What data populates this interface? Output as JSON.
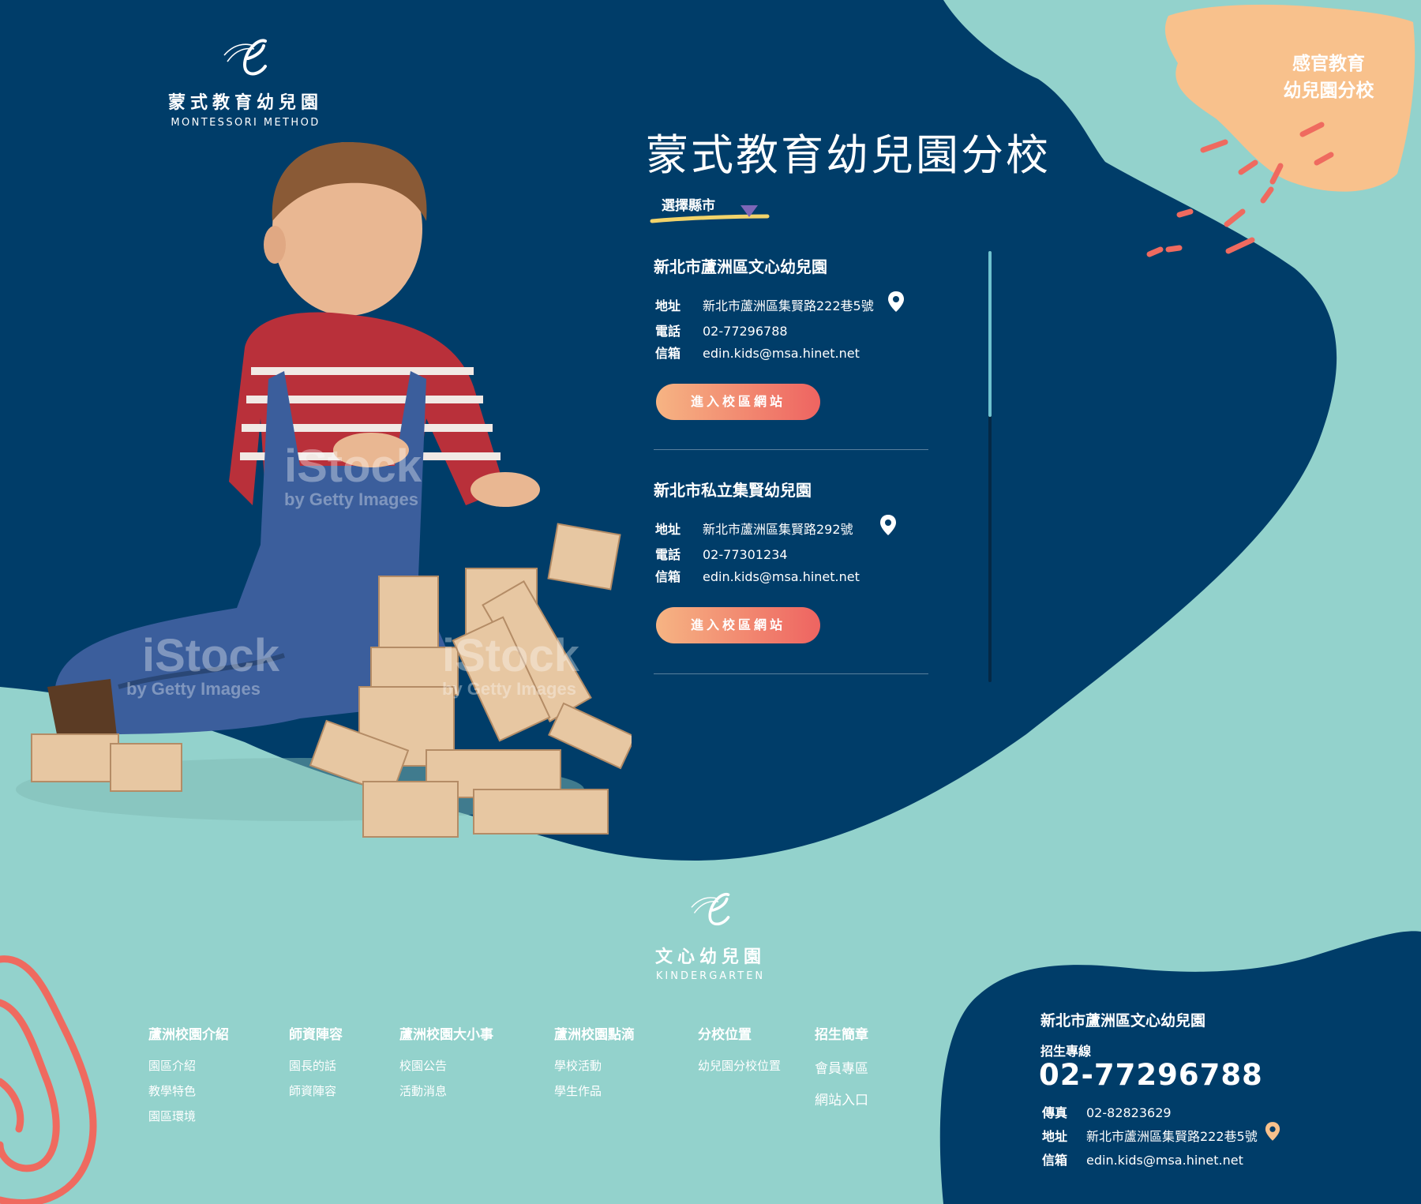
{
  "header": {
    "logo_name": "蒙式教育幼兒園",
    "logo_sub": "MONTESSORI METHOD"
  },
  "hero": {
    "title": "蒙式教育幼兒園分校",
    "city_select_label": "選擇縣市",
    "photo_watermark_1": "iStock",
    "photo_watermark_2": "by Getty Images"
  },
  "schools": [
    {
      "name": "新北市蘆洲區文心幼兒園",
      "address_label": "地址",
      "address": "新北市蘆洲區集賢路222巷5號",
      "phone_label": "電話",
      "phone": "02-77296788",
      "email_label": "信箱",
      "email": "edin.kids@msa.hinet.net",
      "button": "進入校區網站"
    },
    {
      "name": "新北市私立集賢幼兒園",
      "address_label": "地址",
      "address": "新北市蘆洲區集賢路292號",
      "phone_label": "電話",
      "phone": "02-77301234",
      "email_label": "信箱",
      "email": "edin.kids@msa.hinet.net",
      "button": "進入校區網站"
    }
  ],
  "corner_badge": {
    "line1": "感官教育",
    "line2": "幼兒園分校"
  },
  "footer": {
    "logo_name": "文心幼兒園",
    "logo_sub": "KINDERGARTEN",
    "nav": [
      {
        "heading": "蘆洲校園介紹",
        "links": [
          "園區介紹",
          "教學特色",
          "園區環境"
        ]
      },
      {
        "heading": "師資陣容",
        "links": [
          "園長的話",
          "師資陣容"
        ]
      },
      {
        "heading": "蘆洲校園大小事",
        "links": [
          "校園公告",
          "活動消息"
        ]
      },
      {
        "heading": "蘆洲校園點滴",
        "links": [
          "學校活動",
          "學生作品"
        ]
      },
      {
        "heading": "分校位置",
        "links": [
          "幼兒園分校位置"
        ]
      },
      {
        "heading": "招生簡章",
        "links": [
          "會員專區",
          "網站入口"
        ]
      }
    ],
    "contact": {
      "title": "新北市蘆洲區文心幼兒園",
      "hotline_label": "招生專線",
      "hotline": "02-77296788",
      "fax_label": "傳真",
      "fax": "02-82823629",
      "address_label": "地址",
      "address": "新北市蘆洲區集賢路222巷5號",
      "email_label": "信箱",
      "email": "edin.kids@msa.hinet.net"
    }
  },
  "colors": {
    "navy": "#003d69",
    "teal": "#93d2cc",
    "coral": "#ef6a5f",
    "peach": "#f8c18c",
    "yellow": "#f2d36a",
    "purple": "#7d66b8"
  },
  "icons": [
    "logo-swirl-icon",
    "dropdown-triangle-icon",
    "location-pin-icon",
    "brush-splash-decoration",
    "spiral-decoration"
  ]
}
